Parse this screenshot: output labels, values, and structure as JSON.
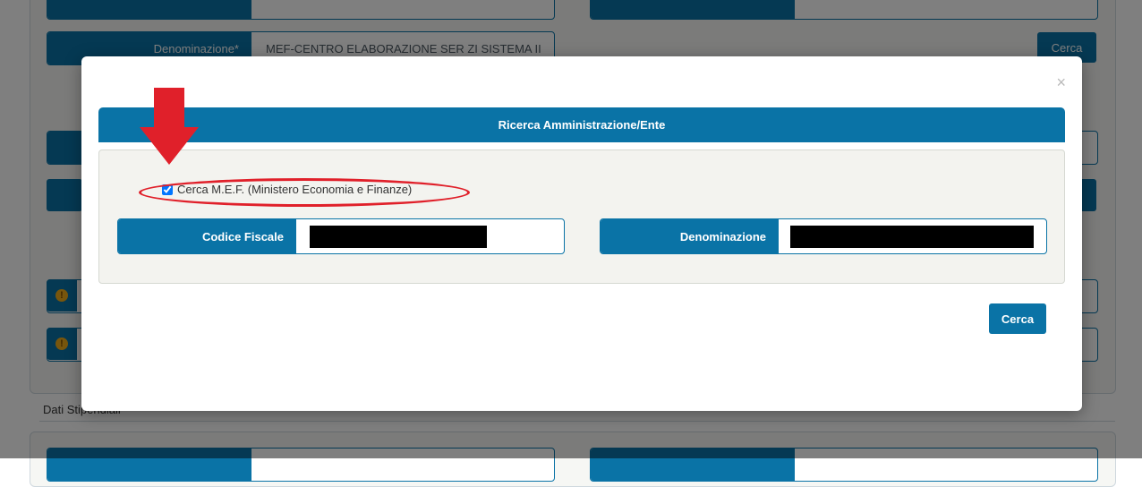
{
  "background": {
    "denominazione_label": "Denominazione*",
    "denominazione_value": "MEF-CENTRO ELABORAZIONE SER ZI SISTEMA II",
    "cerca_label": "Cerca",
    "section_title": "Dati Stipendiali",
    "warning_symbol": "!"
  },
  "modal": {
    "title": "Ricerca Amministrazione/Ente",
    "close_symbol": "×",
    "checkbox_label": "Cerca M.E.F. (Ministero Economia e Finanze)",
    "checkbox_checked": true,
    "codice_fiscale_label": "Codice Fiscale",
    "codice_fiscale_value": "",
    "denominazione_label": "Denominazione",
    "denominazione_value": "",
    "search_button": "Cerca"
  },
  "annotation": {
    "arrow_color": "#e0202a",
    "ellipse_color": "#e0202a"
  },
  "colors": {
    "primary": "#0a73a6",
    "warning": "#f0ad1b"
  }
}
